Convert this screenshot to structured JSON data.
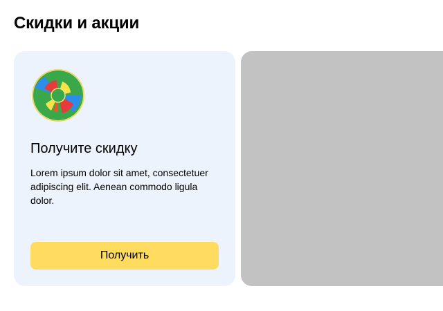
{
  "section": {
    "title": "Скидки и акции"
  },
  "promo_card": {
    "icon": "discount-wheel-icon",
    "heading": "Получите скидку",
    "text": "Lorem ipsum dolor sit amet, consectetuer adipiscing elit. Aenean commodo ligula dolor.",
    "button_label": "Получить"
  },
  "colors": {
    "card_background": "#ecf3fd",
    "button_background": "#ffdc60",
    "placeholder_card": "#c2c2c2"
  }
}
